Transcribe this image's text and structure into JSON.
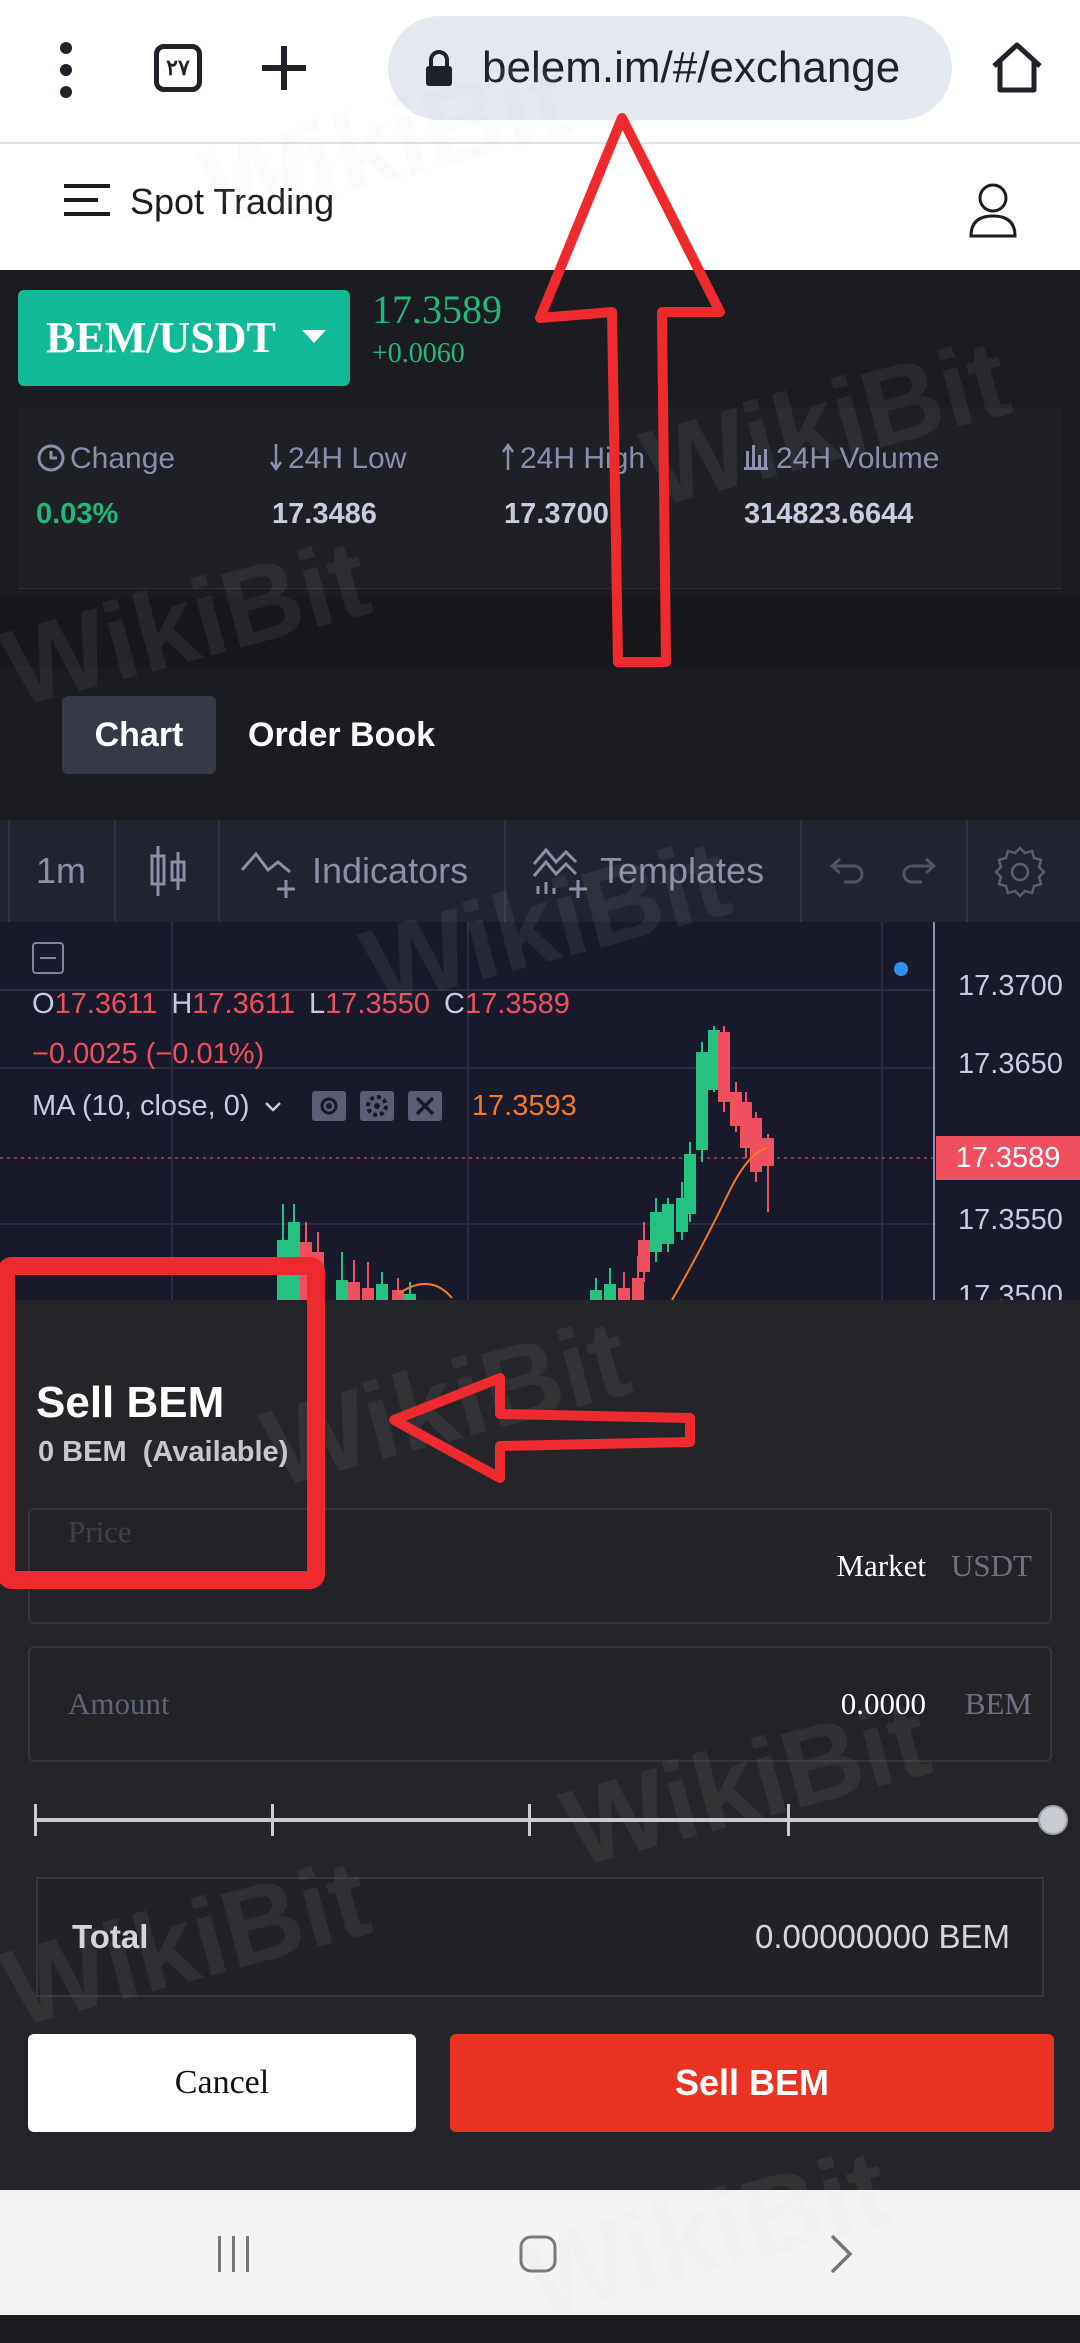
{
  "browser": {
    "tab_count": "۲۷",
    "url": "belem.im/#/exchange",
    "icons": [
      "more-vert-icon",
      "tabs-icon",
      "add-icon",
      "lock-icon",
      "home-icon"
    ]
  },
  "header": {
    "title": "Spot Trading",
    "icons": [
      "menu-icon",
      "user-icon"
    ]
  },
  "ticker": {
    "pair": "BEM/USDT",
    "last_price": "17.3589",
    "price_delta": "+0.0060",
    "stats": [
      {
        "label": "Change",
        "value": "0.03%",
        "icon": "clock-icon"
      },
      {
        "label": "24H Low",
        "value": "17.3486",
        "icon": "arrow-down-icon"
      },
      {
        "label": "24H High",
        "value": "17.3700",
        "icon": "arrow-up-icon"
      },
      {
        "label": "24H Volume",
        "value": "314823.6644",
        "icon": "bar-chart-icon"
      }
    ]
  },
  "tabs": {
    "chart": "Chart",
    "order_book": "Order Book"
  },
  "chart_toolbar": {
    "interval": "1m",
    "indicators": "Indicators",
    "templates": "Templates"
  },
  "chart": {
    "ohlc": {
      "o_label": "O",
      "o": "17.3611",
      "h_label": "H",
      "h": "17.3611",
      "l_label": "L",
      "l": "17.3550",
      "c_label": "C",
      "c": "17.3589"
    },
    "change": "−0.0025 (−0.01%)",
    "ma_label": "MA (10, close, 0)",
    "ma_value": "17.3593",
    "price_axis": [
      "17.3700",
      "17.3650",
      "17.3550",
      "17.3500"
    ],
    "current_price_tag": "17.3589",
    "colors": {
      "up": "#26c281",
      "down": "#ef4f5e",
      "ma": "#f07a25",
      "bg": "#181a2b"
    }
  },
  "sell": {
    "title": "Sell BEM",
    "available_amount": "0 BEM",
    "available_suffix": "(Available)",
    "price": {
      "placeholder": "Price",
      "value": "Market",
      "unit": "USDT"
    },
    "amount": {
      "placeholder": "Amount",
      "value": "0.0000",
      "unit": "BEM"
    },
    "slider_percent": 100,
    "total_label": "Total",
    "total_value": "0.00000000 BEM",
    "cancel_label": "Cancel",
    "sell_label": "Sell BEM"
  },
  "nav": {
    "icons": [
      "recent-apps-icon",
      "home-button-icon",
      "back-icon"
    ]
  },
  "watermark": "WikiBit",
  "colors": {
    "accent": "#12b997",
    "sell": "#ea3323",
    "positive": "#1fb978",
    "annotation": "#ee2a2f"
  }
}
